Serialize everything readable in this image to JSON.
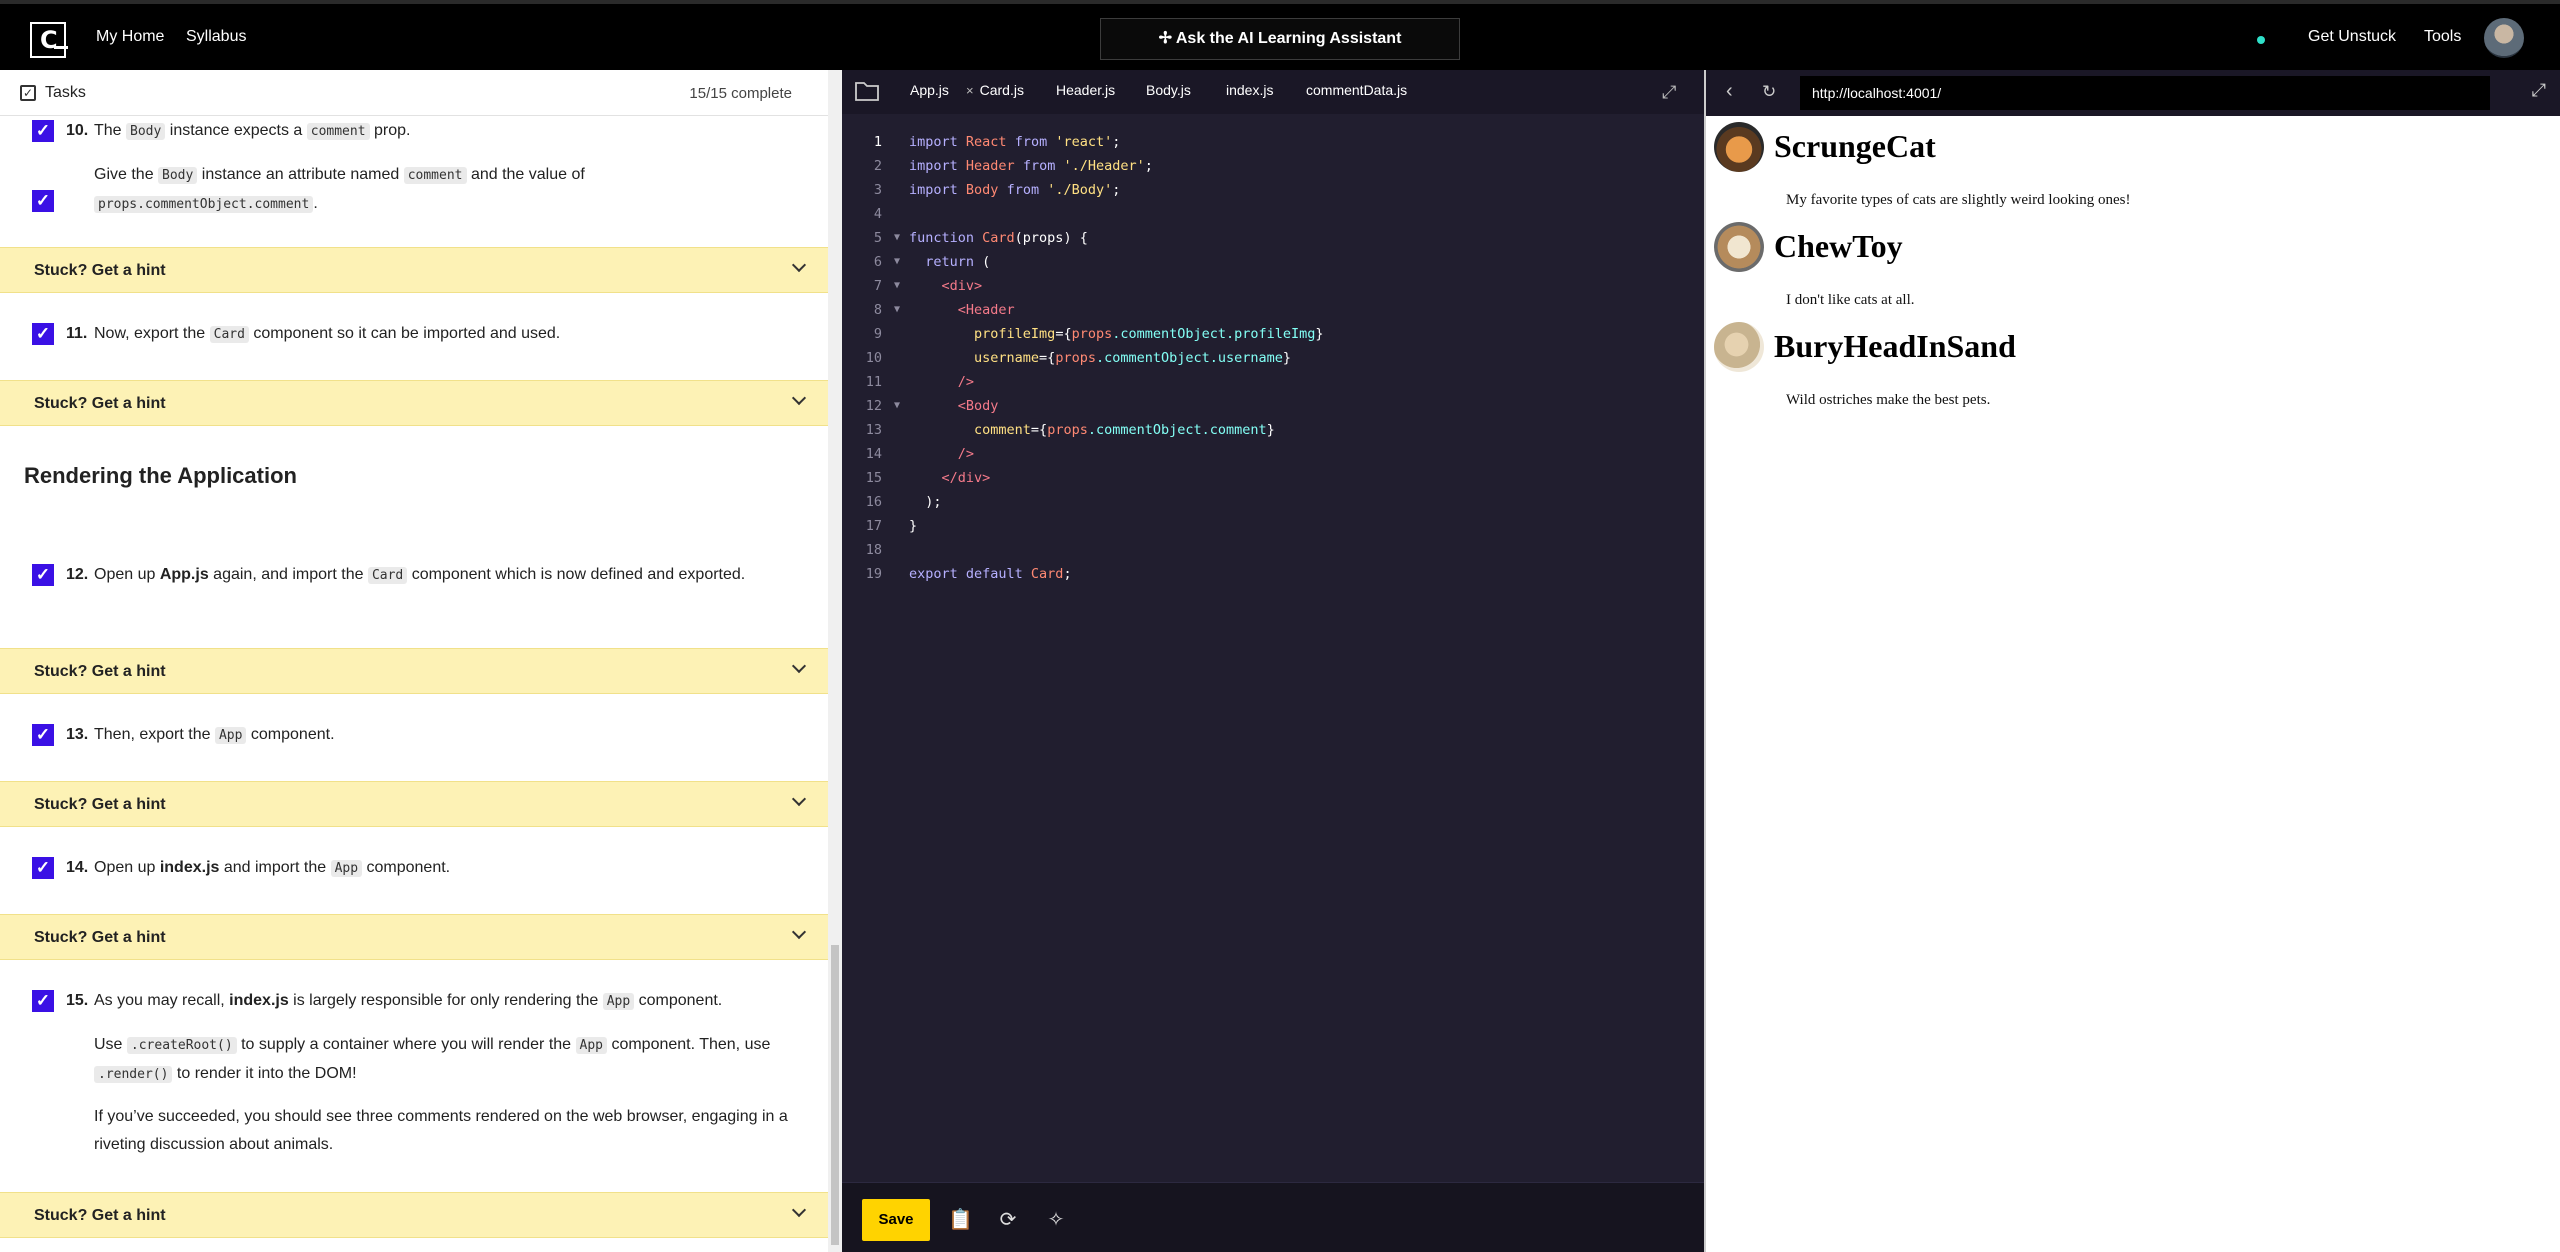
{
  "nav": {
    "logo_letter": "C",
    "home": "My Home",
    "syllabus": "Syllabus",
    "ai_button": "Ask the AI Learning Assistant",
    "get_unstuck": "Get Unstuck",
    "tools": "Tools"
  },
  "tasks": {
    "title": "Tasks",
    "count": "15/15 complete",
    "section_title": "Rendering the Application",
    "hint_label": "Stuck? Get a hint",
    "items": [
      {
        "num": "10.",
        "p1_a": "The ",
        "p1_code": "Body",
        "p1_b": " instance expects a ",
        "p1_code2": "comment",
        "p1_c": " prop.",
        "p2_a": "Give the ",
        "p2_code": "Body",
        "p2_b": " instance an attribute named ",
        "p2_code2": "comment",
        "p2_c": " and the value of",
        "p2_code3": "props.commentObject.comment",
        "p2_d": "."
      },
      {
        "num": "11.",
        "a": "Now, export the ",
        "code": "Card",
        "b": " component so it can be imported and used."
      },
      {
        "num": "12.",
        "a": "Open up ",
        "bold": "App.js",
        "b": " again, and import the ",
        "code": "Card",
        "c": " component which is now defined and exported."
      },
      {
        "num": "13.",
        "a": "Then, export the ",
        "code": "App",
        "b": " component."
      },
      {
        "num": "14.",
        "a": "Open up ",
        "bold": "index.js",
        "b": " and import the ",
        "code": "App",
        "c": " component."
      },
      {
        "num": "15.",
        "p1_a": "As you may recall, ",
        "p1_bold": "index.js",
        "p1_b": " is largely responsible for only rendering the ",
        "p1_code": "App",
        "p1_c": " component.",
        "p2_a": "Use ",
        "p2_code": ".createRoot()",
        "p2_b": " to supply a container where you will render the ",
        "p2_code2": "App",
        "p2_c": " component. Then, use ",
        "p2_code3": ".render()",
        "p2_d": " to render it into the DOM!",
        "p3": "If you’ve succeeded, you should see three comments rendered on the web browser, engaging in a riveting discussion about animals."
      }
    ]
  },
  "editor": {
    "tabs": [
      "App.js",
      "Card.js",
      "Header.js",
      "Body.js",
      "index.js",
      "commentData.js"
    ],
    "active_tab": "Card.js",
    "save_label": "Save",
    "lines": {
      "l1": {
        "k": "import",
        "n": " React ",
        "f": "from",
        "s": " 'react'",
        "e": ";"
      },
      "l2": {
        "k": "import",
        "n": " Header ",
        "f": "from",
        "s": " './Header'",
        "e": ";"
      },
      "l3": {
        "k": "import",
        "n": " Body ",
        "f": "from",
        "s": " './Body'",
        "e": ";"
      },
      "l5a": "function",
      "l5b": " Card",
      "l5c": "(props) {",
      "l6a": "  return",
      "l6b": " (",
      "l7": "    <div>",
      "l8": "      <Header",
      "l9a": "        profileImg",
      "l9b": "={",
      "l9c": "props",
      "l9d": ".commentObject.profileImg",
      "l9e": "}",
      "l10a": "        username",
      "l10b": "={",
      "l10c": "props",
      "l10d": ".commentObject.username",
      "l10e": "}",
      "l11": "      />",
      "l12": "      <Body",
      "l13a": "        comment",
      "l13b": "={",
      "l13c": "props",
      "l13d": ".commentObject.comment",
      "l13e": "}",
      "l14": "      />",
      "l15": "    </div>",
      "l16": "  );",
      "l17": "}",
      "l19a": "export default",
      "l19b": " Card",
      "l19c": ";"
    }
  },
  "browser": {
    "url": "http://localhost:4001/",
    "comments": [
      {
        "username": "ScrungeCat",
        "comment": "My favorite types of cats are slightly weird looking ones!"
      },
      {
        "username": "ChewToy",
        "comment": "I don't like cats at all."
      },
      {
        "username": "BuryHeadInSand",
        "comment": "Wild ostriches make the best pets."
      }
    ]
  },
  "colors": {
    "accent": "#3a10e5",
    "hint_bg": "#fdf2b5",
    "save": "#ffd300",
    "status_dot": "#2fe0c9"
  }
}
